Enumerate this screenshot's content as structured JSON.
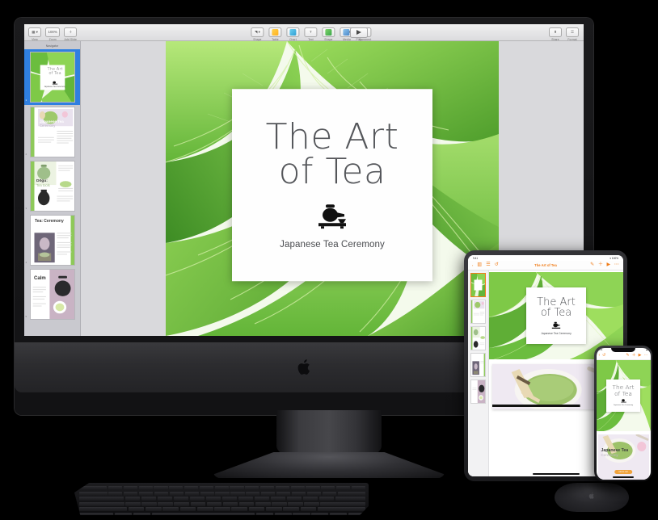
{
  "scene": {
    "description": "Apple device family showing Keynote presentation",
    "devices": [
      "Pro Display XDR",
      "iPad Pro",
      "iPhone"
    ]
  },
  "presentation": {
    "title": "The Art of Tea",
    "title_line1": "The Art",
    "title_line2": "of Tea",
    "subtitle": "Japanese Tea Ceremony",
    "icon": "teapot-icon",
    "slide_count": 5,
    "current_slide": 1,
    "slides": [
      {
        "number": "1",
        "title": "The Art of Tea",
        "subtitle": "Japanese Tea Ceremony",
        "theme": "title-leaf"
      },
      {
        "number": "2",
        "title": "Japanese Tea",
        "subtitle": "Ceremony",
        "theme": "matcha-whisk"
      },
      {
        "number": "3",
        "title": "Dōgu:",
        "subtitle": "Tea tools",
        "theme": "teapot-matcha"
      },
      {
        "number": "4",
        "title": "Tea: Ceremony",
        "subtitle": "",
        "theme": "ceremony-setting"
      },
      {
        "number": "5",
        "title": "Calm",
        "subtitle": "",
        "theme": "iron-teapot"
      }
    ]
  },
  "mac": {
    "app_name": "Keynote",
    "toolbar": {
      "left_items": [
        {
          "label": "View",
          "icon": "view-icon"
        },
        {
          "label": "Zoom",
          "icon": "zoom-value",
          "value": "100%"
        },
        {
          "label": "Add Slide",
          "icon": "plus-icon"
        }
      ],
      "navigator_label": "Navigator",
      "center_items": [
        {
          "label": "Shape",
          "icon": "shape-icon"
        },
        {
          "label": "Table",
          "icon": "table-icon"
        },
        {
          "label": "Chart",
          "icon": "chart-icon"
        },
        {
          "label": "Text",
          "icon": "text-icon"
        },
        {
          "label": "Shape",
          "icon": "square-icon"
        },
        {
          "label": "Media",
          "icon": "media-icon"
        },
        {
          "label": "Comment",
          "icon": "comment-icon"
        }
      ],
      "play": {
        "label": "Play",
        "icon": "play-icon"
      },
      "right_items": [
        {
          "label": "Share",
          "icon": "share-icon"
        },
        {
          "label": "Format",
          "icon": "format-icon"
        }
      ]
    }
  },
  "ipad": {
    "status": {
      "time": "9:41",
      "wifi": "wifi-icon",
      "battery": "100%"
    },
    "title": "The Art of Tea",
    "left_items": [
      {
        "label": "Presentations",
        "icon": "back-chevron-icon"
      },
      {
        "label": "View",
        "icon": "sidebar-icon"
      },
      {
        "label": "Outline",
        "icon": "list-icon"
      },
      {
        "label": "Undo",
        "icon": "undo-icon"
      }
    ],
    "right_items": [
      {
        "label": "Format",
        "icon": "paintbrush-icon"
      },
      {
        "label": "Insert",
        "icon": "plus-icon"
      },
      {
        "label": "Play",
        "icon": "play-icon"
      },
      {
        "label": "More",
        "icon": "ellipsis-icon"
      }
    ]
  },
  "iphone": {
    "status": {
      "time": "9:41",
      "battery": "battery-icon"
    },
    "left_items": [
      {
        "label": "Back",
        "icon": "back-chevron-icon"
      },
      {
        "label": "Undo",
        "icon": "undo-icon"
      }
    ],
    "right_items": [
      {
        "label": "Format",
        "icon": "paintbrush-icon"
      },
      {
        "label": "Insert",
        "icon": "plus-icon"
      },
      {
        "label": "Play",
        "icon": "play-icon"
      },
      {
        "label": "More",
        "icon": "ellipsis-icon"
      }
    ],
    "slide2_title": "Japanese Tea",
    "slide2_subtitle": "Ceremony",
    "badge": "Add to cart"
  },
  "accessories": {
    "keyboard": "Magic Keyboard",
    "mouse": "Magic Mouse"
  },
  "colors": {
    "accent_orange": "#f07d1a",
    "selection_blue": "#2f7fe0",
    "leaf_green": "#7ec24a",
    "card_white": "#fefefe"
  }
}
